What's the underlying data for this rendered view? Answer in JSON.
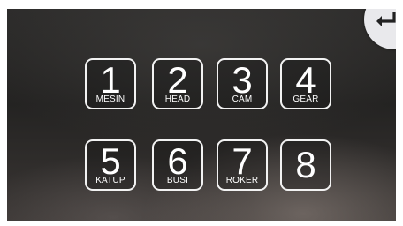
{
  "keypad": {
    "keys": [
      {
        "number": "1",
        "label": "MESIN"
      },
      {
        "number": "2",
        "label": "HEAD"
      },
      {
        "number": "3",
        "label": "CAM"
      },
      {
        "number": "4",
        "label": "GEAR"
      },
      {
        "number": "5",
        "label": "KATUP"
      },
      {
        "number": "6",
        "label": "BUSI"
      },
      {
        "number": "7",
        "label": "ROKER"
      },
      {
        "number": "8",
        "label": ""
      }
    ]
  },
  "back_button": {
    "icon": "back-arrow-icon"
  },
  "colors": {
    "key_border": "#f2f2f2",
    "key_text": "#ffffff",
    "background": "#2c2b2a",
    "back_badge": "#e9e9ec"
  }
}
